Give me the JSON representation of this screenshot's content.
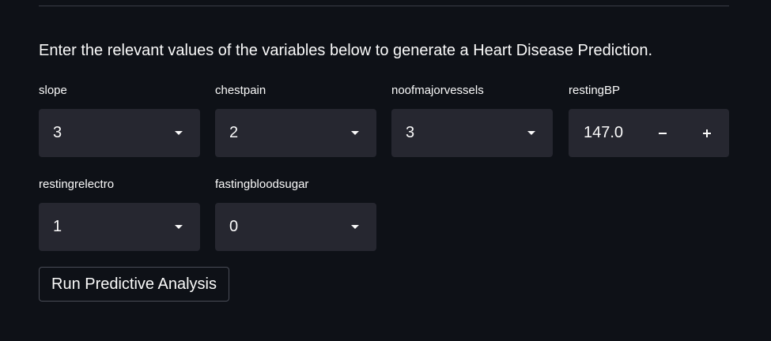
{
  "intro_text": "Enter the relevant values of the variables below to generate a Heart Disease Prediction.",
  "fields": {
    "slope": {
      "label": "slope",
      "value": "3"
    },
    "chestpain": {
      "label": "chestpain",
      "value": "2"
    },
    "noofmajorvessels": {
      "label": "noofmajorvessels",
      "value": "3"
    },
    "restingBP": {
      "label": "restingBP",
      "value": "147.0"
    },
    "restingrelectro": {
      "label": "restingrelectro",
      "value": "1"
    },
    "fastingbloodsugar": {
      "label": "fastingbloodsugar",
      "value": "0"
    }
  },
  "run_button_label": "Run Predictive Analysis",
  "colors": {
    "background": "#0e1117",
    "widget_background": "#262730",
    "text": "#fafafa"
  },
  "icons": {
    "select_indicator": "chevron-down-icon",
    "decrement": "minus-icon",
    "increment": "plus-icon"
  }
}
